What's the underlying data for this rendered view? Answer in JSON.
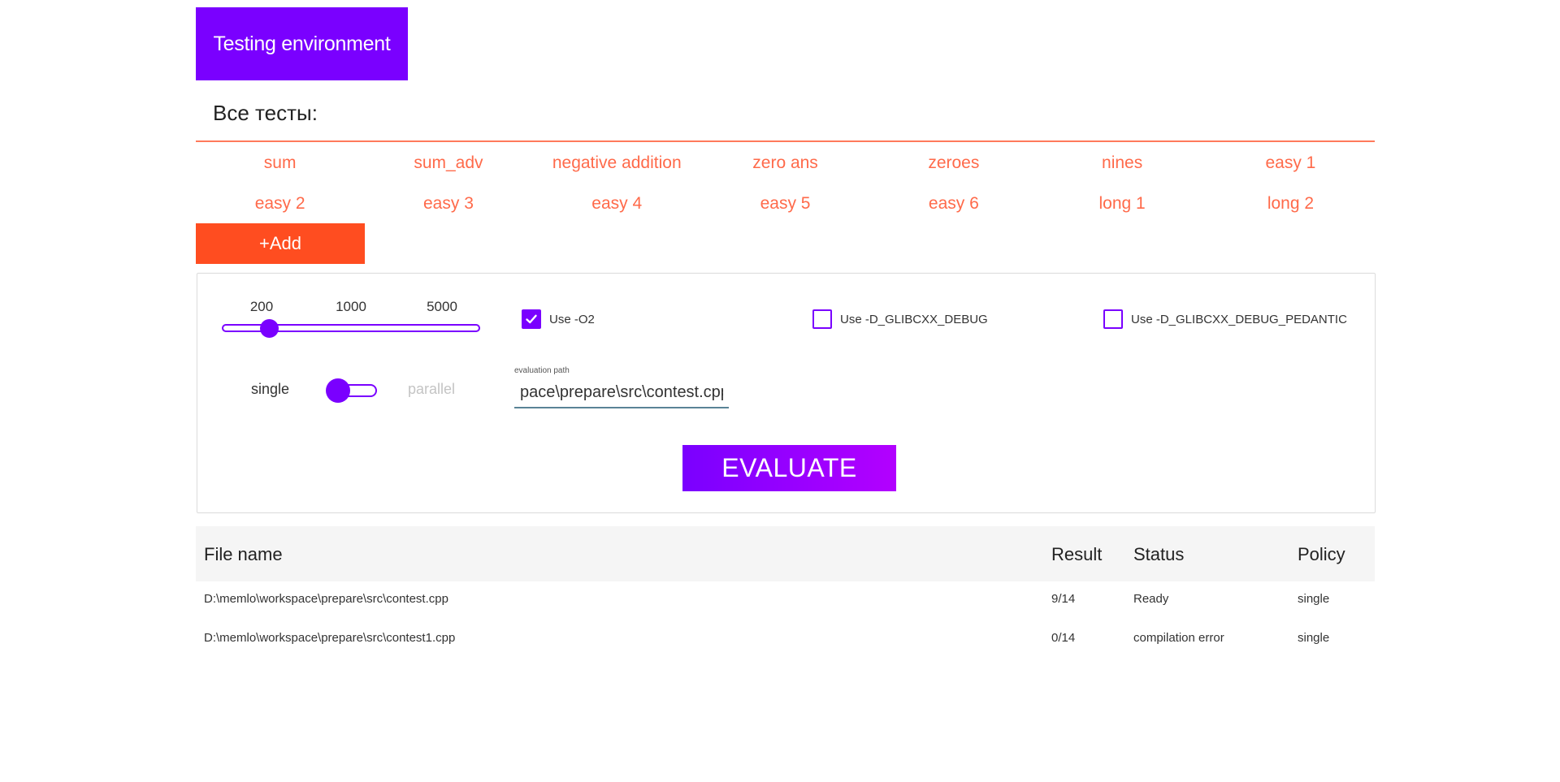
{
  "header": {
    "title": "Testing environment"
  },
  "tests": {
    "title": "Все тесты:",
    "items": [
      "sum",
      "sum_adv",
      "negative addition",
      "zero ans",
      "zeroes",
      "nines",
      "easy 1",
      "easy 2",
      "easy 3",
      "easy 4",
      "easy 5",
      "easy 6",
      "long 1",
      "long 2"
    ],
    "add_label": "+Add"
  },
  "settings": {
    "slider": {
      "labels": [
        "200",
        "1000",
        "5000"
      ],
      "selected": "200"
    },
    "options": [
      {
        "label": "Use -O2",
        "checked": true
      },
      {
        "label": "Use -D_GLIBCXX_DEBUG",
        "checked": false
      },
      {
        "label": "Use -D_GLIBCXX_DEBUG_PEDANTIC",
        "checked": false
      }
    ],
    "policy": {
      "left_label": "single",
      "right_label": "parallel",
      "selected": "single"
    },
    "path": {
      "caption": "evaluation path",
      "value": "pace\\prepare\\src\\contest.cpp"
    },
    "evaluate_label": "EVALUATE"
  },
  "results": {
    "columns": [
      "File name",
      "Result",
      "Status",
      "Policy"
    ],
    "rows": [
      {
        "file": "D:\\memlo\\workspace\\prepare\\src\\contest.cpp",
        "result": "9/14",
        "status": "Ready",
        "policy": "single"
      },
      {
        "file": "D:\\memlo\\workspace\\prepare\\src\\contest1.cpp",
        "result": "0/14",
        "status": "compilation error",
        "policy": "single"
      }
    ]
  },
  "colors": {
    "primary": "#7a00ff",
    "accent": "#ff4d20",
    "test_link": "#ff6a4a"
  }
}
